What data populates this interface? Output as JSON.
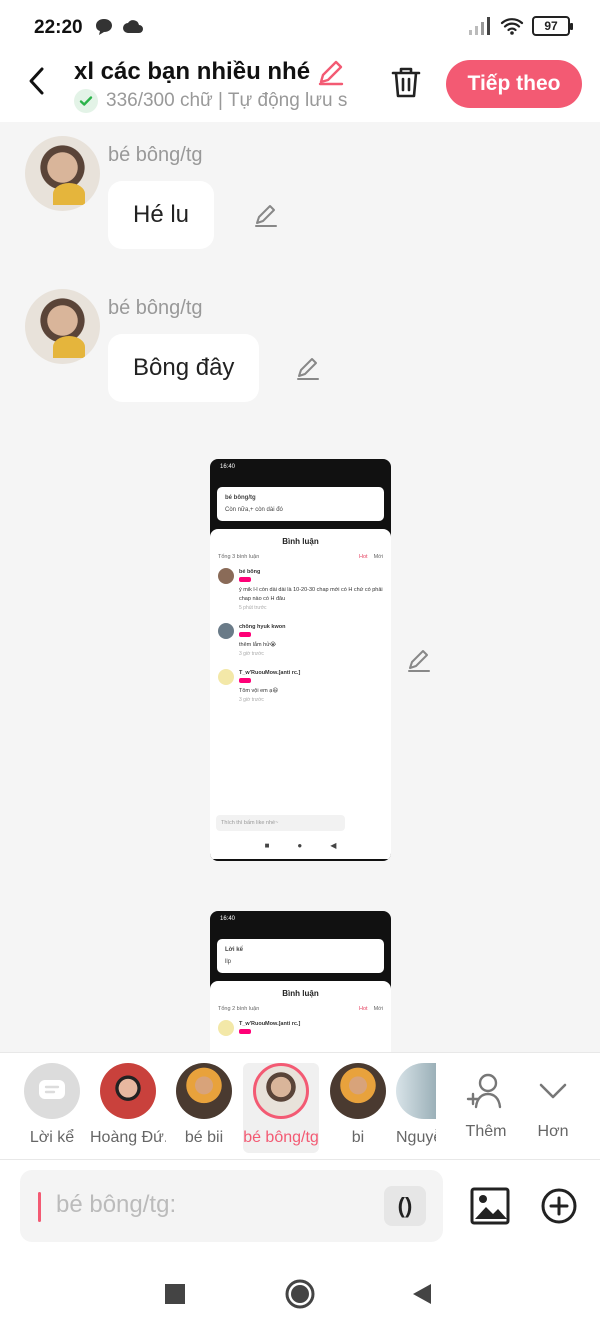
{
  "status_bar": {
    "time": "22:20",
    "battery": "97"
  },
  "header": {
    "title": "xl các bạn nhiều nhé",
    "subtitle": "336/300 chữ | Tự động lưu s",
    "next_label": "Tiếp theo"
  },
  "messages": [
    {
      "sender": "bé bông/tg",
      "text": "Hé lu"
    },
    {
      "sender": "bé bông/tg",
      "text": "Bông đây"
    }
  ],
  "embedded_screens": [
    {
      "time": "16:40",
      "quote_name": "bé bông/tg",
      "quote_text": "Còn nữa,+ còn dài đó",
      "panel_title": "Bình luận",
      "count": "Tổng 3 bình luận",
      "sort_hot": "Hot",
      "sort_new": "Mới",
      "comments": [
        {
          "name": "bé bông",
          "text": "ý mik l-l còn dài dài là 10-20-30 chap mới có H chứ có phải chap nào có H đâu",
          "time": "5 phút trước"
        },
        {
          "name": "chông hyuk kwon",
          "text": "thêm lắm hử😭",
          "time": "3 giờ trước"
        },
        {
          "name": "T_w'RuouMow.[anti rc.]",
          "text": "Tôm vội em ạ😆",
          "time": "3 giờ trước"
        }
      ],
      "input_placeholder": "Thích thì bấm like nhé~"
    },
    {
      "time": "16:40",
      "quote_name": "Lời kể",
      "quote_text": "llp",
      "panel_title": "Bình luận",
      "count": "Tổng 2 bình luận",
      "sort_hot": "Hot",
      "sort_new": "Mới",
      "comments": [
        {
          "name": "T_w'RuouMow.[anti rc.]",
          "text": "",
          "time": ""
        }
      ]
    }
  ],
  "speakers": [
    {
      "label": "Lời kể"
    },
    {
      "label": "Hoàng Đứ..."
    },
    {
      "label": "bé bii"
    },
    {
      "label": "bé bông/tg",
      "active": true
    },
    {
      "label": "bi"
    },
    {
      "label": "Nguyễ"
    }
  ],
  "speaker_actions": {
    "add_label": "Thêm",
    "more_label": "Hơn"
  },
  "composer": {
    "prefix": "bé bông/tg:",
    "paren_label": "()"
  },
  "colors": {
    "accent": "#f35a73",
    "check_green": "#2bb34a",
    "background": "#f5f5f5"
  }
}
